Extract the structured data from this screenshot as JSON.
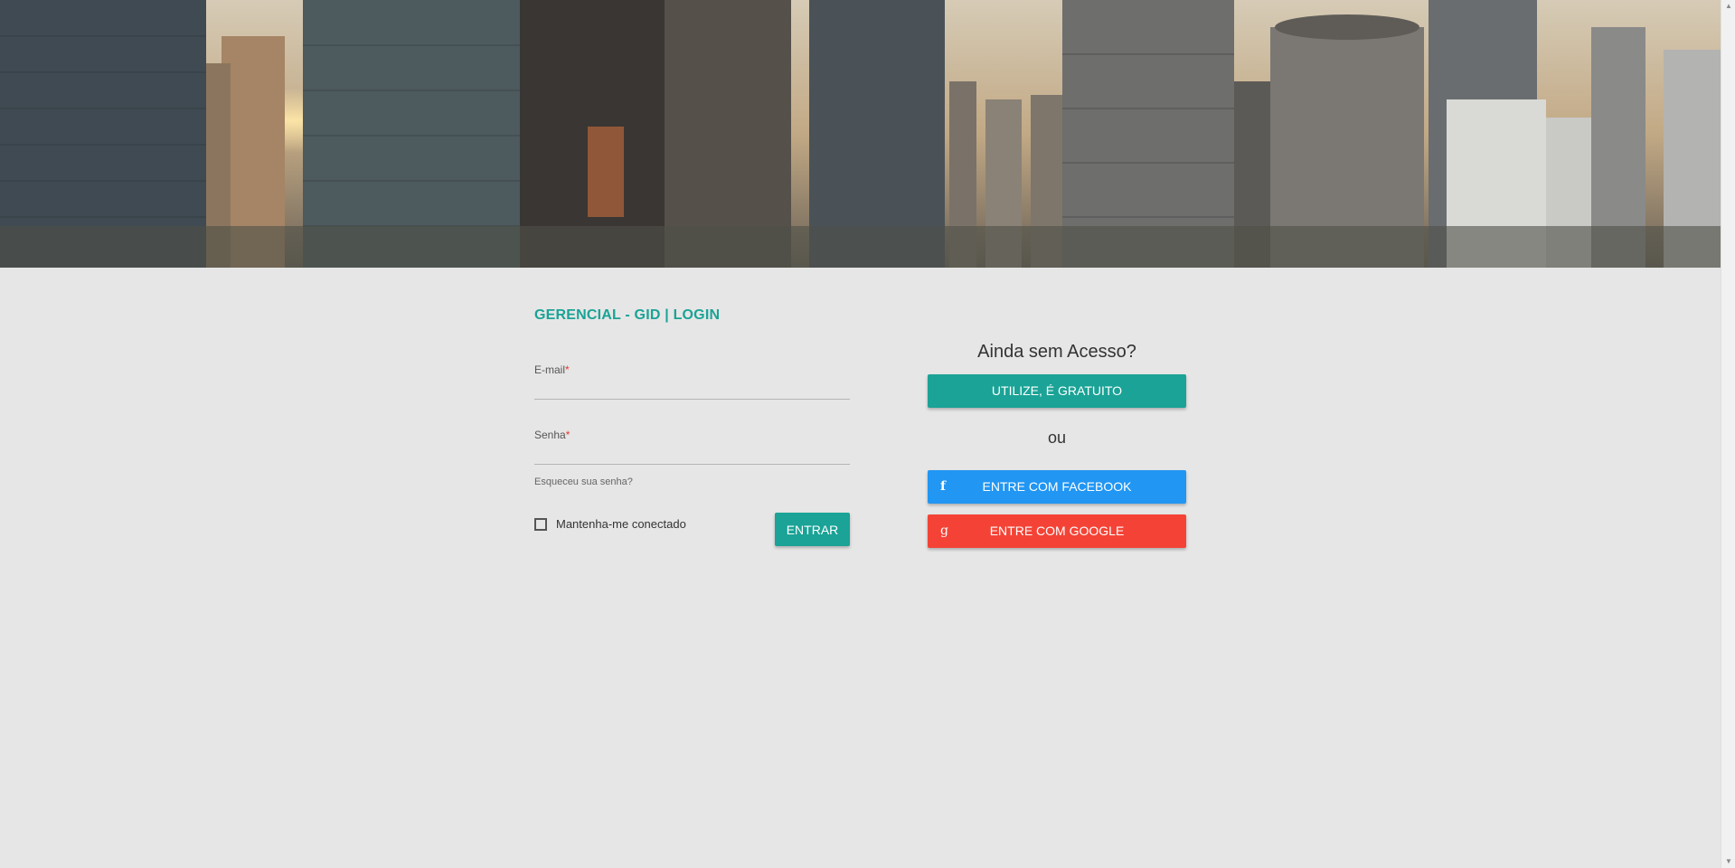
{
  "login": {
    "title": "GERENCIAL - GID | LOGIN",
    "email_label": "E-mail",
    "email_required": "*",
    "email_value": "",
    "password_label": "Senha",
    "password_required": "*",
    "password_value": "",
    "forgot_link": "Esqueceu sua senha?",
    "remember_label": "Mantenha-me conectado",
    "remember_checked": false,
    "submit_label": "ENTRAR"
  },
  "signup": {
    "title": "Ainda sem Acesso?",
    "free_button": "UTILIZE, É GRATUITO",
    "or_text": "ou",
    "facebook_button": "ENTRE COM FACEBOOK",
    "facebook_icon": "f",
    "google_button": "ENTRE COM GOOGLE",
    "google_icon": "g"
  },
  "colors": {
    "accent": "#1aa396",
    "facebook": "#2196f3",
    "google": "#f44336",
    "background": "#e6e6e6"
  }
}
